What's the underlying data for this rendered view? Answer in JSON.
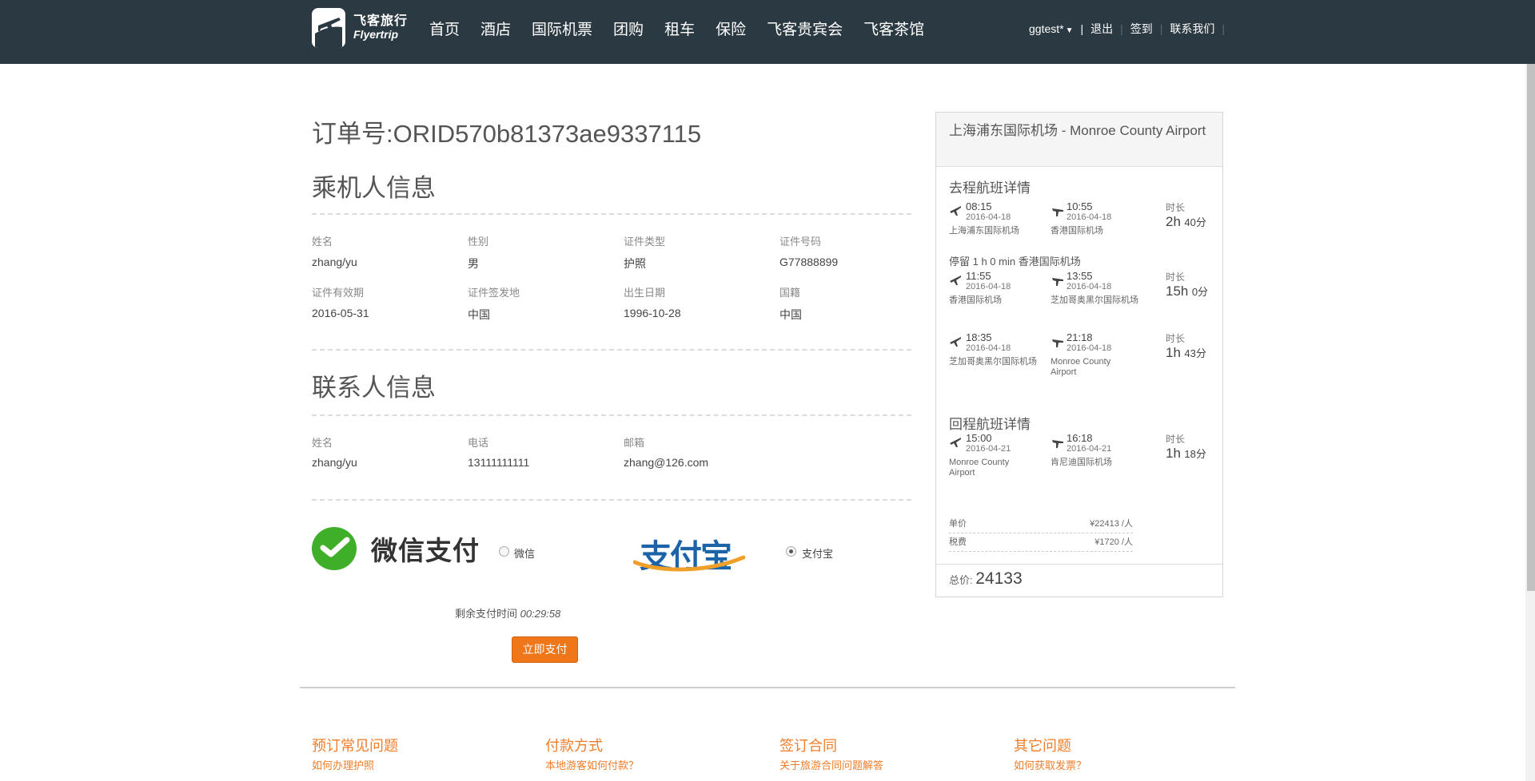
{
  "header": {
    "logo_cn": "飞客旅行",
    "logo_en": "Flyertrip",
    "nav": [
      "首页",
      "酒店",
      "国际机票",
      "团购",
      "租车",
      "保险",
      "飞客贵宾会",
      "飞客茶馆"
    ],
    "user": "ggtest*",
    "logout": "退出",
    "checkin": "签到",
    "contact": "联系我们",
    "separator": "|"
  },
  "order": {
    "title": "订单号:ORID570b81373ae9337115"
  },
  "passenger": {
    "section_title": "乘机人信息",
    "fields": [
      {
        "label": "姓名",
        "value": "zhang/yu"
      },
      {
        "label": "性别",
        "value": "男"
      },
      {
        "label": "证件类型",
        "value": "护照"
      },
      {
        "label": "证件号码",
        "value": "G77888899"
      },
      {
        "label": "证件有效期",
        "value": "2016-05-31"
      },
      {
        "label": "证件签发地",
        "value": "中国"
      },
      {
        "label": "出生日期",
        "value": "1996-10-28"
      },
      {
        "label": "国籍",
        "value": "中国"
      }
    ]
  },
  "contact": {
    "section_title": "联系人信息",
    "fields": [
      {
        "label": "姓名",
        "value": "zhang/yu"
      },
      {
        "label": "电话",
        "value": "13111111111"
      },
      {
        "label": "邮箱",
        "value": "zhang@126.com"
      }
    ]
  },
  "payment": {
    "wechat_logo_text": "微信支付",
    "wechat_label": "微信",
    "alipay_logo_text": "支付宝",
    "alipay_label": "支付宝",
    "selected": "alipay",
    "timer_label": "剩余支付时间",
    "timer_value": "00:29:58",
    "pay_button": "立即支付"
  },
  "footer": {
    "columns": [
      {
        "title": "预订常见问题",
        "link": "如何办理护照"
      },
      {
        "title": "付款方式",
        "link": "本地游客如何付款？"
      },
      {
        "title": "签订合同",
        "link": "关于旅游合同问题解答"
      },
      {
        "title": "其它问题",
        "link": "如何获取发票？"
      }
    ]
  },
  "flight": {
    "route": "上海浦东国际机场 - Monroe County Airport",
    "outbound_title": "去程航班详情",
    "return_title": "回程航班详情",
    "duration_label": "时长",
    "stop_text": "停留 1 h 0 min 香港国际机场",
    "outbound": [
      {
        "dep_time": "08:15",
        "dep_date": "2016-04-18",
        "dep_airport": "上海浦东国际机场",
        "arr_time": "10:55",
        "arr_date": "2016-04-18",
        "arr_airport": "香港国际机场",
        "dur_h": "2h",
        "dur_m": "40分"
      },
      {
        "dep_time": "11:55",
        "dep_date": "2016-04-18",
        "dep_airport": "香港国际机场",
        "arr_time": "13:55",
        "arr_date": "2016-04-18",
        "arr_airport": "芝加哥奥黑尔国际机场",
        "dur_h": "15h",
        "dur_m": "0分"
      },
      {
        "dep_time": "18:35",
        "dep_date": "2016-04-18",
        "dep_airport": "芝加哥奥黑尔国际机场",
        "arr_time": "21:18",
        "arr_date": "2016-04-18",
        "arr_airport": "Monroe County Airport",
        "dur_h": "1h",
        "dur_m": "43分"
      }
    ],
    "return": [
      {
        "dep_time": "15:00",
        "dep_date": "2016-04-21",
        "dep_airport": "Monroe County Airport",
        "arr_time": "16:18",
        "arr_date": "2016-04-21",
        "arr_airport": "肯尼迪国际机场",
        "dur_h": "1h",
        "dur_m": "18分"
      }
    ],
    "price": {
      "unit_label": "单价",
      "unit_value": "¥22413 /人",
      "tax_label": "税费",
      "tax_value": "¥1720 /人",
      "total_label": "总价:",
      "total_value": "24133"
    }
  },
  "colors": {
    "topbar": "#2b3942",
    "accent_orange": "#f0761a",
    "wechat_green": "#3fae29",
    "alipay_blue": "#1d63a8"
  }
}
